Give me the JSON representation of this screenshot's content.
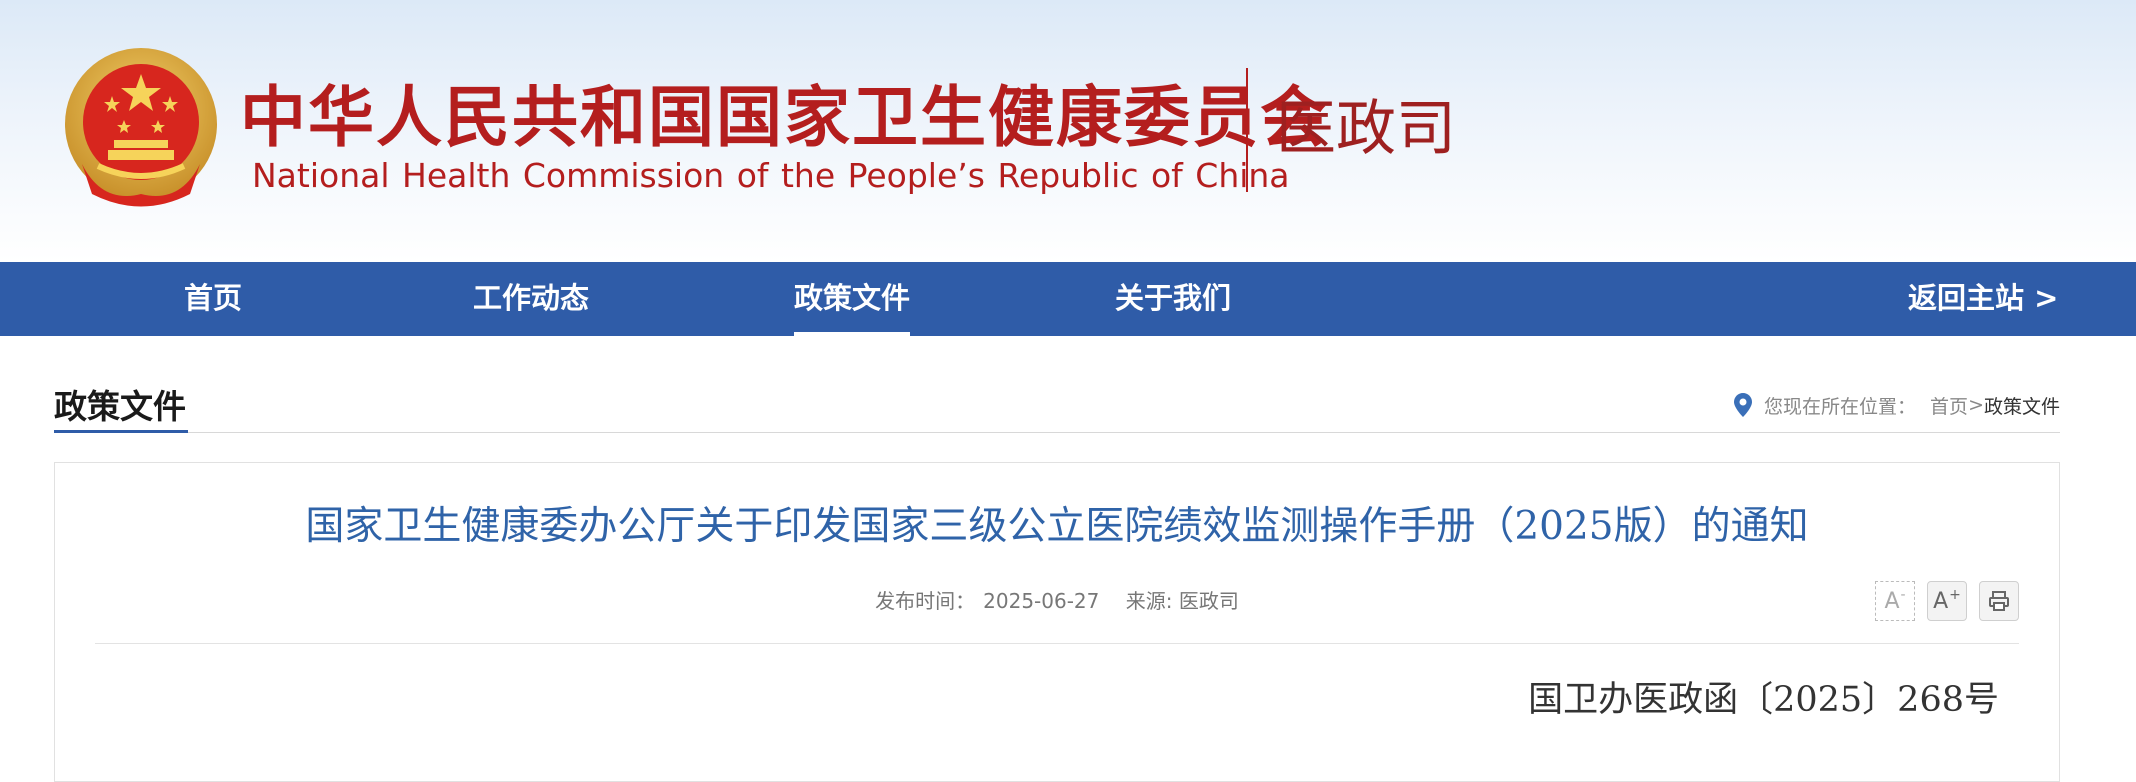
{
  "header": {
    "title_cn": "中华人民共和国国家卫生健康委员会",
    "title_en": "National Health Commission of the People’s  Republic of China",
    "department": "医政司",
    "colors": {
      "brand_red": "#b41e1e",
      "emblem_gold": "#e0b23a"
    }
  },
  "nav": {
    "items": [
      {
        "label": "首页"
      },
      {
        "label": "工作动态"
      },
      {
        "label": "政策文件",
        "active": true
      },
      {
        "label": "关于我们"
      }
    ],
    "return_label": "返回主站 >",
    "background": "#2f5ca8"
  },
  "section": {
    "title": "政策文件"
  },
  "breadcrumb": {
    "prefix": "您现在所在位置：",
    "home": "首页",
    "separator": ">",
    "current": "政策文件",
    "icon": "location-pin-icon"
  },
  "article": {
    "title": "国家卫生健康委办公厅关于印发国家三级公立医院绩效监测操作手册（2025版）的通知",
    "publish_label": "发布时间：",
    "publish_date": "2025-06-27",
    "source_label": "来源: ",
    "source": "医政司",
    "doc_number": "国卫办医政函〔2025〕268号"
  },
  "tools": {
    "decrease_font_label": "A",
    "decrease_font_mark": "-",
    "increase_font_label": "A",
    "increase_font_mark": "+",
    "print_icon": "printer-icon"
  }
}
